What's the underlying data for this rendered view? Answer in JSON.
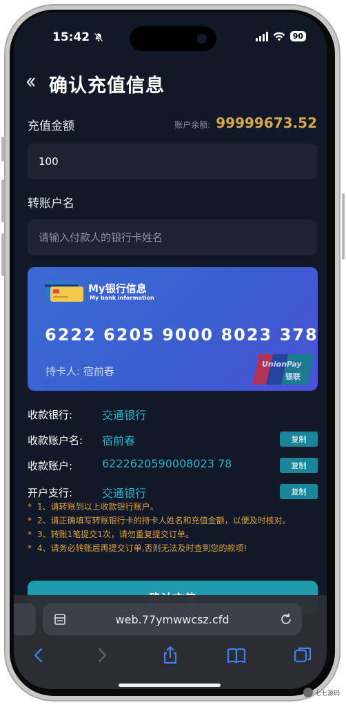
{
  "status_bar": {
    "time": "15:42",
    "battery": "90"
  },
  "header": {
    "back_icon": "chevron-double-left-icon",
    "title": "确认充值信息"
  },
  "amount": {
    "label": "充值金额",
    "balance_label": "账户余额:",
    "balance_value": "99999673.52",
    "value": "100"
  },
  "transfer_name": {
    "label": "转账户名",
    "placeholder": "请输入付款人的银行卡姓名"
  },
  "card": {
    "title": "My银行信息",
    "subtitle": "My bank information",
    "number": "6222 6205 9000 8023 378",
    "holder": "持卡人:  宿前春",
    "brand_text": "UnionPay 银联"
  },
  "receiver": {
    "bank_label": "收款银行:",
    "bank_value": "交通银行",
    "name_label": "收款账户名:",
    "name_value": "宿前春",
    "account_label": "收款账户:",
    "account_value": "6222620590008023 78",
    "branch_label": "开户支行:",
    "branch_value": "交通银行",
    "copy_label": "复制"
  },
  "notes": [
    "1、请转账到以上收款银行账户。",
    "2、请正确填写转账银行卡的持卡人姓名和充值金额，以便及时核对。",
    "3、转账1笔提交1次，请勿重复提交订单。",
    "4、请务必转账后再提交订单,否则无法及时查到您的款项!"
  ],
  "confirm_label": "确认充值",
  "browser": {
    "url": "web.77ymwwcsz.cfd"
  },
  "watermark": "七七源码",
  "colors": {
    "background": "#111827",
    "accent": "#1f9bad",
    "balance": "#d4a853",
    "note": "#e0a13c",
    "value_text": "#27b3c7"
  }
}
